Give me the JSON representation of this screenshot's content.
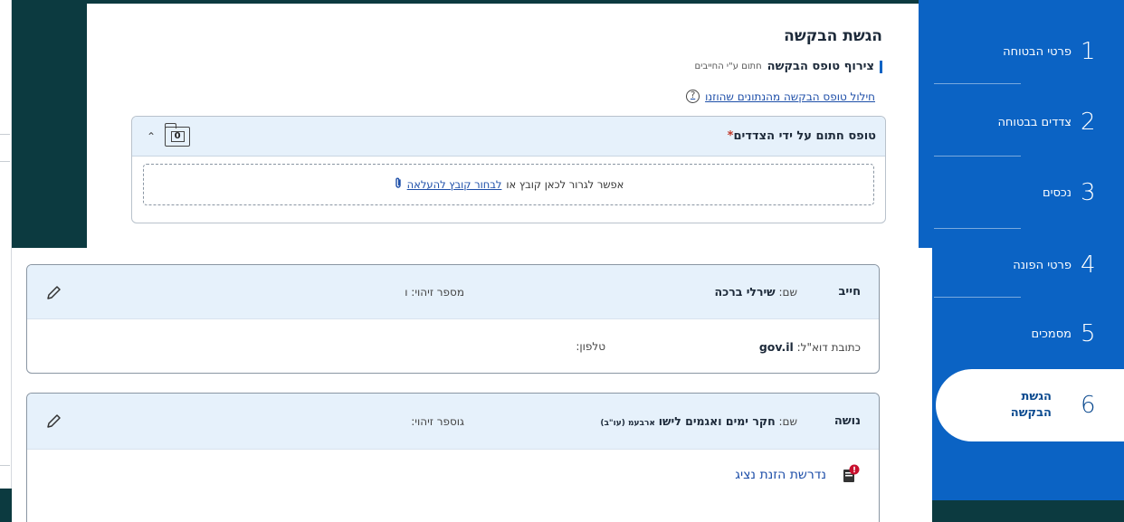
{
  "stepper": {
    "steps": [
      {
        "num": "1",
        "label": "פרטי הבטוחה"
      },
      {
        "num": "2",
        "label": "צדדים בבטוחה"
      },
      {
        "num": "3",
        "label": "נכסים"
      },
      {
        "num": "4",
        "label": "פרטי הפונה"
      },
      {
        "num": "5",
        "label": "מסמכים"
      },
      {
        "num": "6",
        "label": "הגשת הבקשה"
      }
    ],
    "active_index": 5
  },
  "submit": {
    "title": "הגשת הבקשה",
    "attach_label": "צירוף טופס הבקשה",
    "attach_sub": "חתום ע\"י החייבים",
    "extract_link": "חילול טופס הבקשה מהנתונים שהוזנו",
    "help_icon": "?",
    "form_label": "טופס חתום על ידי הצדדים",
    "required_mark": "*",
    "file_count": "0",
    "drop_text": "אפשר לגרור לכאן קובץ או",
    "choose_link": "לבחור קובץ להעלאה"
  },
  "parties": [
    {
      "role": "חייב",
      "name_label": "שם:",
      "name_value": "שירלי ברכה",
      "id_label": "מספר זיהוי:",
      "id_value": "ו",
      "email_label": "כתובת דוא\"ל:",
      "email_value": "gov.il",
      "phone_label": "טלפון:"
    },
    {
      "role": "נושה",
      "name_label": "שם:",
      "name_value": "חקר ימים ואגמים לישו",
      "name_value_tail": "ארבעמ (עו\"ב)",
      "id_label": "גוספר זיהוי:",
      "rep_link": "נדרשת הזנת נציג"
    }
  ],
  "colors": {
    "stepper_bg": "#0b63c4",
    "header_bg": "#e6f1fb",
    "link": "#1d4ea8",
    "warning": "#c8102e"
  },
  "icons": [
    "chevron-up-icon",
    "folder-icon",
    "paperclip-icon",
    "help-icon",
    "pencil-icon",
    "warning-document-icon"
  ]
}
